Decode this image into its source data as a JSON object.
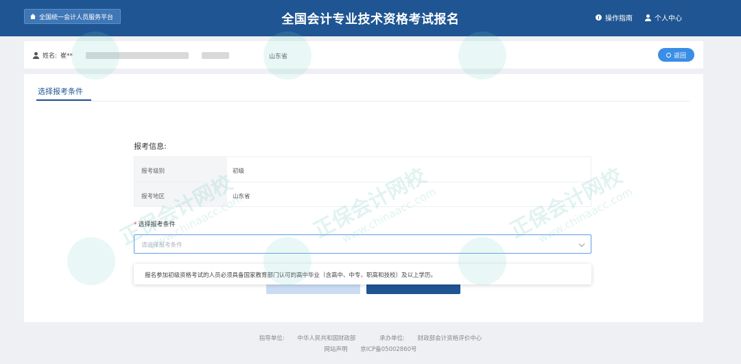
{
  "header": {
    "platform_label": "全国统一会计人员服务平台",
    "title": "全国会计专业技术资格考试报名",
    "guide_label": "操作指南",
    "personal_center_label": "个人中心",
    "bg_color": "#1e5592"
  },
  "userbar": {
    "name_label": "姓名:",
    "name_value": "崔**",
    "province": "山东省",
    "back_label": "返回"
  },
  "main": {
    "tab_label": "选择报考条件",
    "section_title": "报考信息:",
    "info_rows": [
      {
        "key": "报考级别",
        "value": "初级"
      },
      {
        "key": "报考地区",
        "value": "山东省"
      }
    ],
    "select_label": "选择报考条件",
    "select_placeholder": "请选择报考条件",
    "dropdown_option": "报名参加初级资格考试的人员必须具备国家教育部门认可的高中毕业（含高中、中专、职高和技校）及以上学历。"
  },
  "footer": {
    "host_label": "指导单位:",
    "host_value": "中华人民共和国财政部",
    "org_label": "承办单位:",
    "org_value": "财政部会计资格评价中心",
    "statement": "网站声明",
    "icp": "京ICP备05002860号"
  },
  "watermark": {
    "brand": "正保会计网校",
    "url": "www.chinaacc.com"
  },
  "icons": [
    "home-icon",
    "info-icon",
    "person-icon",
    "back-icon",
    "chevron-down-icon"
  ]
}
